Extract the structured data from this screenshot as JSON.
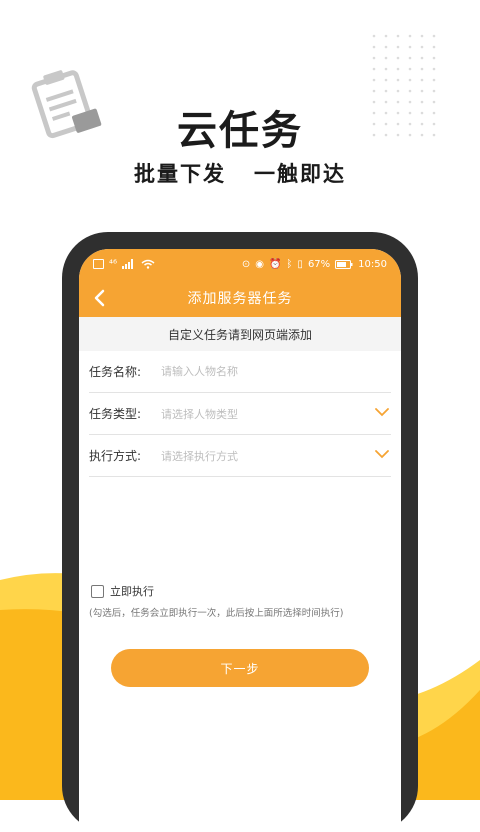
{
  "promo": {
    "headline": "云任务",
    "tagline": "批量下发   一触即达"
  },
  "statusbar": {
    "network": "⁴⁶",
    "battery": "67%",
    "time": "10:50"
  },
  "navbar": {
    "back_icon": "chevron-left-icon",
    "title": "添加服务器任务"
  },
  "hint": "自定义任务请到网页端添加",
  "form": {
    "name": {
      "label": "任务名称:",
      "placeholder": "请输入人物名称",
      "value": ""
    },
    "type": {
      "label": "任务类型:",
      "placeholder": "请选择人物类型"
    },
    "mode": {
      "label": "执行方式:",
      "placeholder": "请选择执行方式"
    }
  },
  "immediate": {
    "label": "立即执行",
    "checked": false,
    "note": "(勾选后，任务会立即执行一次，此后按上面所选择时间执行)"
  },
  "next_button": "下一步",
  "colors": {
    "accent": "#f6a433",
    "wave_light": "#ffd54a",
    "wave_dark": "#fbb81c"
  }
}
